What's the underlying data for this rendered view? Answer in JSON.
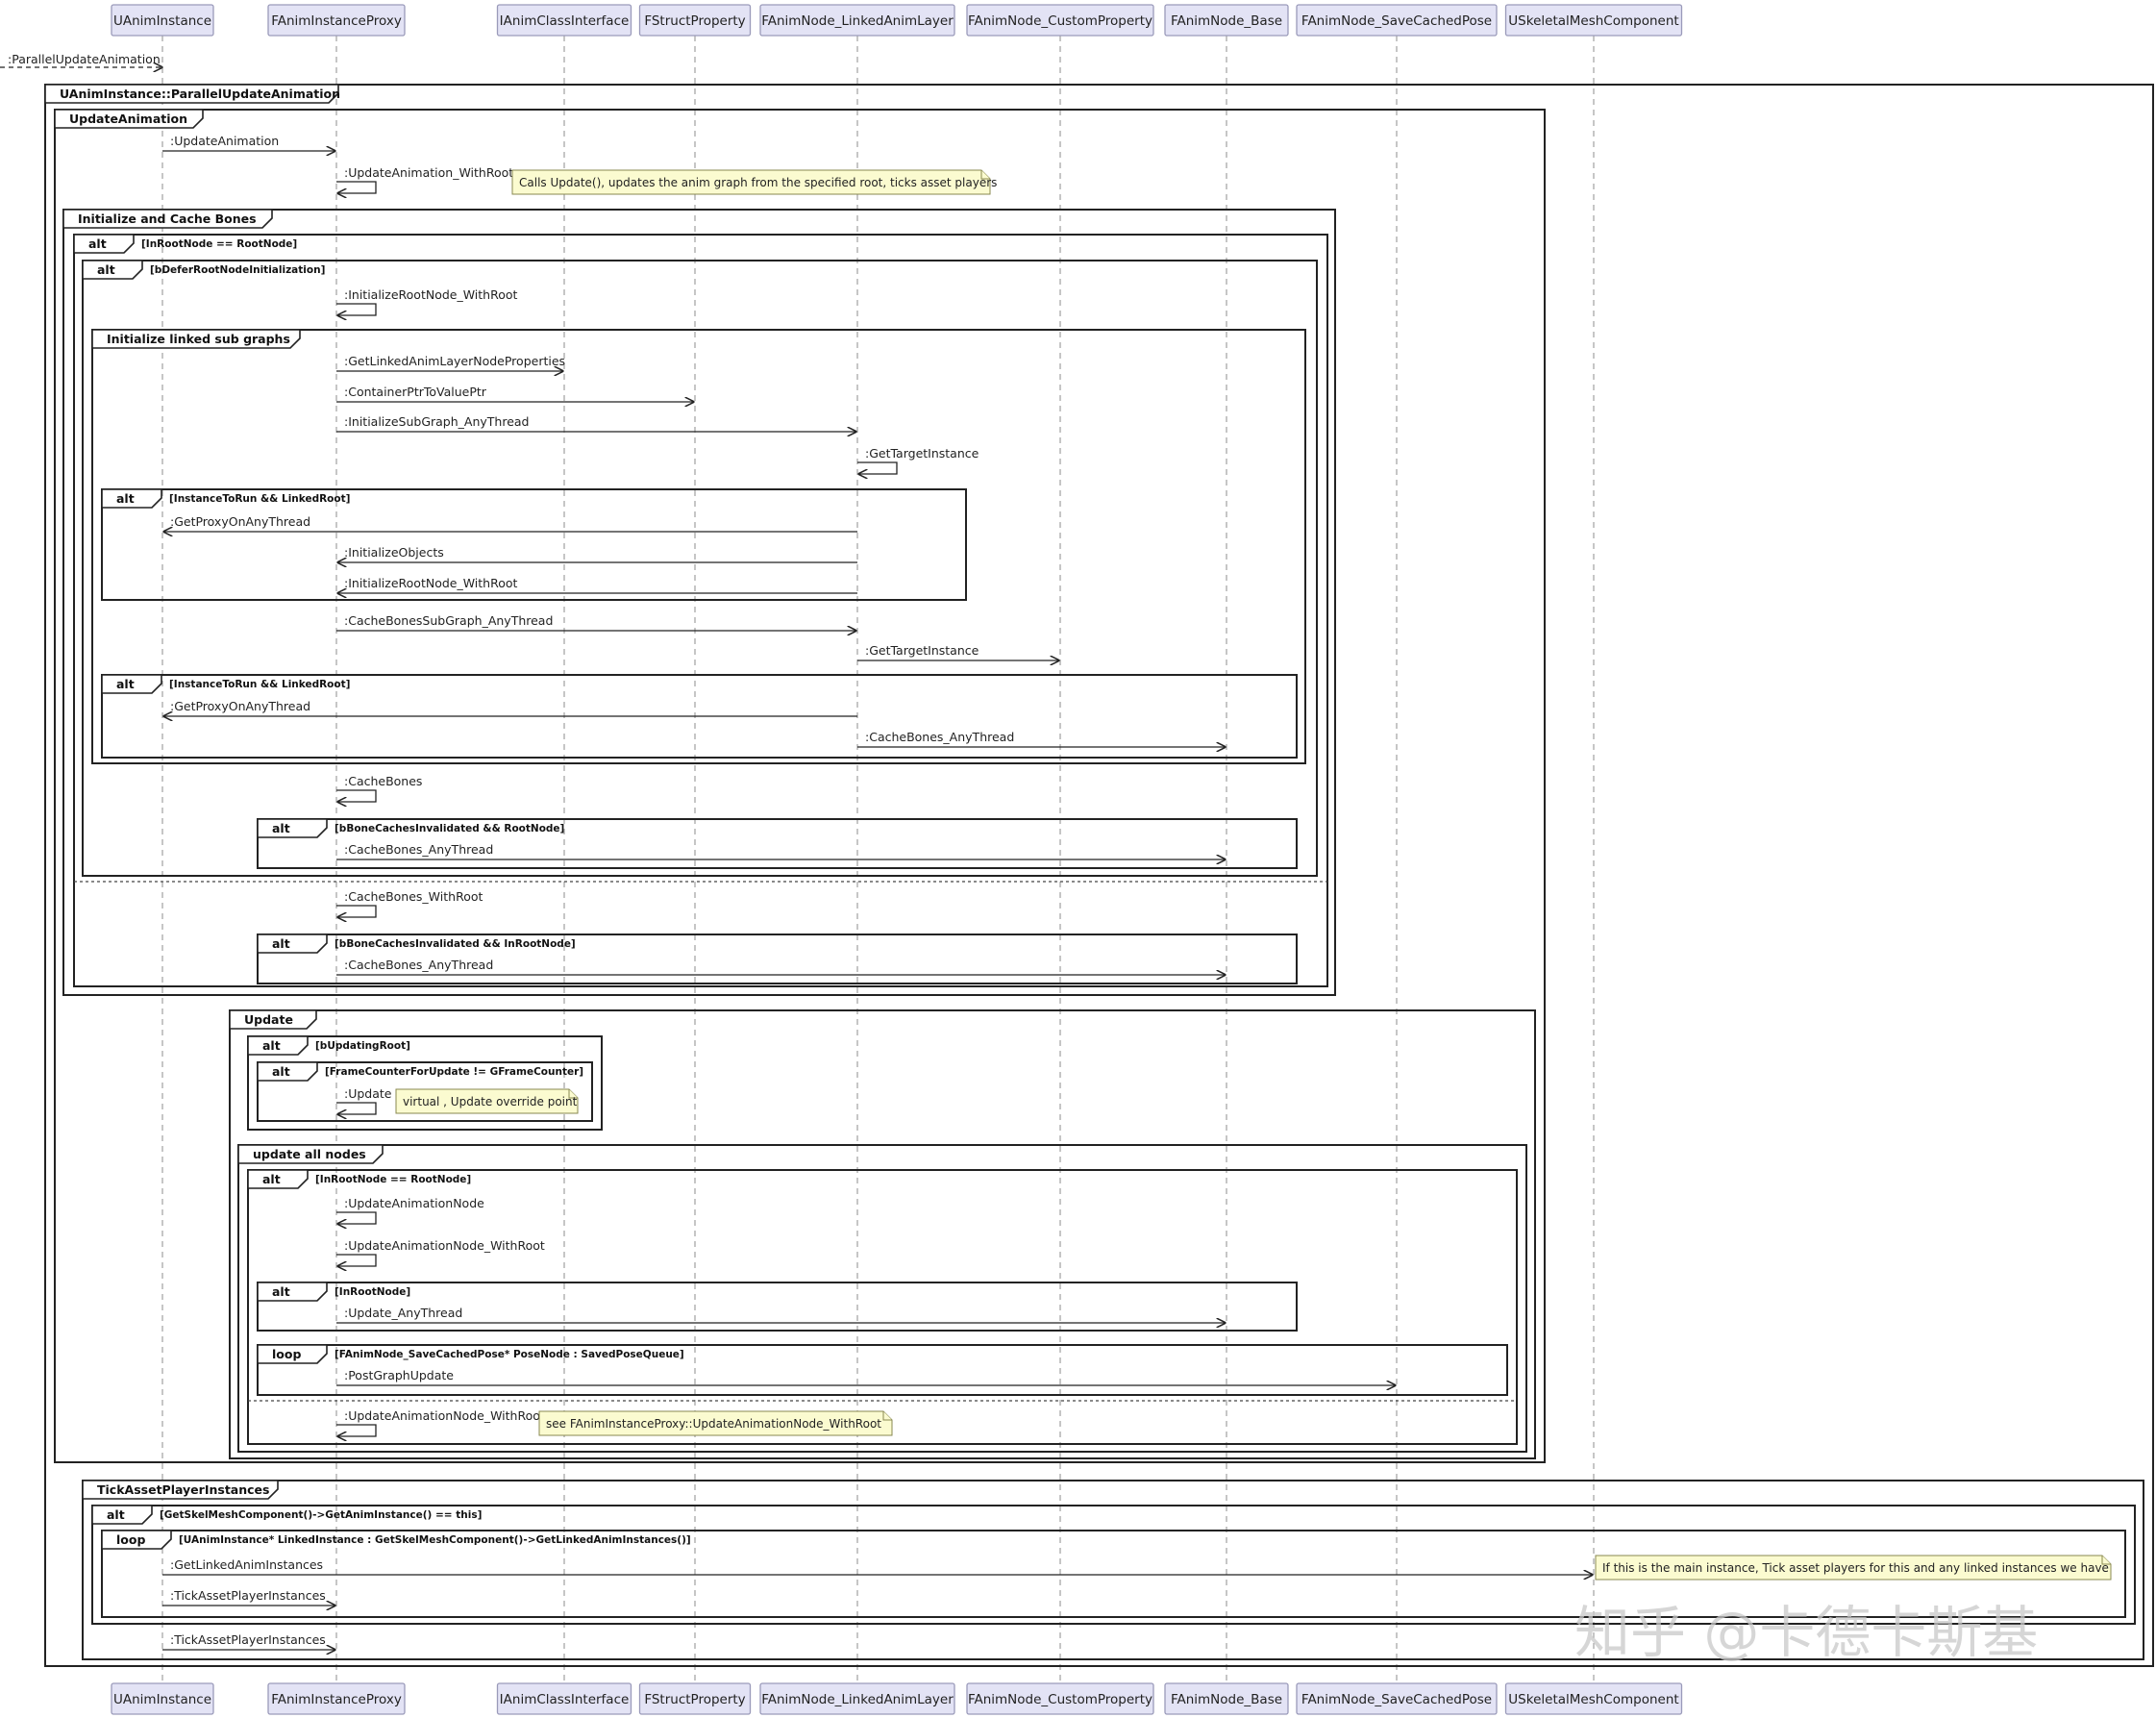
{
  "participants": [
    "UAnimInstance",
    "FAnimInstanceProxy",
    "IAnimClassInterface",
    "FStructProperty",
    "FAnimNode_LinkedAnimLayer",
    "FAnimNode_CustomProperty",
    "FAnimNode_Base",
    "FAnimNode_SaveCachedPose",
    "USkeletalMeshComponent"
  ],
  "entry_message": ":ParallelUpdateAnimation",
  "frames": {
    "parallel": "UAnimInstance::ParallelUpdateAnimation",
    "update_animation": "UpdateAnimation",
    "init_cache": "Initialize and Cache Bones",
    "alt_root": "alt",
    "alt_root_guard": "[InRootNode == RootNode]",
    "alt_defer": "alt",
    "alt_defer_guard": "[bDeferRootNodeInitialization]",
    "init_linked": "Initialize linked sub graphs",
    "alt_run1": "alt",
    "alt_run1_guard": "[InstanceToRun && LinkedRoot]",
    "alt_run2": "alt",
    "alt_run2_guard": "[InstanceToRun && LinkedRoot]",
    "alt_invalid1": "alt",
    "alt_invalid1_guard": "[bBoneCachesInvalidated && RootNode]",
    "alt_invalid2": "alt",
    "alt_invalid2_guard": "[bBoneCachesInvalidated && InRootNode]",
    "update": "Update",
    "alt_updating_root": "alt",
    "alt_updating_root_guard": "[bUpdatingRoot]",
    "alt_frame_counter": "alt",
    "alt_frame_counter_guard": "[FrameCounterForUpdate != GFrameCounter]",
    "update_all_nodes": "update all nodes",
    "alt_root2": "alt",
    "alt_root2_guard": "[InRootNode == RootNode]",
    "alt_in_root": "alt",
    "alt_in_root_guard": "[InRootNode]",
    "loop_saved": "loop",
    "loop_saved_guard": "[FAnimNode_SaveCachedPose* PoseNode : SavedPoseQueue]",
    "tick_asset": "TickAssetPlayerInstances",
    "alt_skel": "alt",
    "alt_skel_guard": "[GetSkelMeshComponent()->GetAnimInstance() == this]",
    "loop_linked": "loop",
    "loop_linked_guard": "[UAnimInstance* LinkedInstance : GetSkelMeshComponent()->GetLinkedAnimInstances()]"
  },
  "messages": [
    ":UpdateAnimation",
    ":UpdateAnimation_WithRoot",
    ":InitializeRootNode_WithRoot",
    ":GetLinkedAnimLayerNodeProperties",
    ":ContainerPtrToValuePtr",
    ":InitializeSubGraph_AnyThread",
    ":GetTargetInstance",
    ":GetProxyOnAnyThread",
    ":InitializeObjects",
    ":InitializeRootNode_WithRoot",
    ":CacheBonesSubGraph_AnyThread",
    ":GetTargetInstance",
    ":GetProxyOnAnyThread",
    ":CacheBones_AnyThread",
    ":CacheBones",
    ":CacheBones_AnyThread",
    ":CacheBones_WithRoot",
    ":CacheBones_AnyThread",
    ":Update",
    ":UpdateAnimationNode",
    ":UpdateAnimationNode_WithRoot",
    ":Update_AnyThread",
    ":PostGraphUpdate",
    ":UpdateAnimationNode_WithRoot",
    ":GetLinkedAnimInstances",
    ":TickAssetPlayerInstances",
    ":TickAssetPlayerInstances"
  ],
  "notes": [
    "Calls Update(), updates the anim graph from the specified root, ticks asset players",
    "virtual , Update override point",
    "see FAnimInstanceProxy::UpdateAnimationNode_WithRoot",
    "If this is the main instance,  Tick asset players for this and any linked instances we have"
  ],
  "watermark": "知乎 @卡德卡斯基"
}
